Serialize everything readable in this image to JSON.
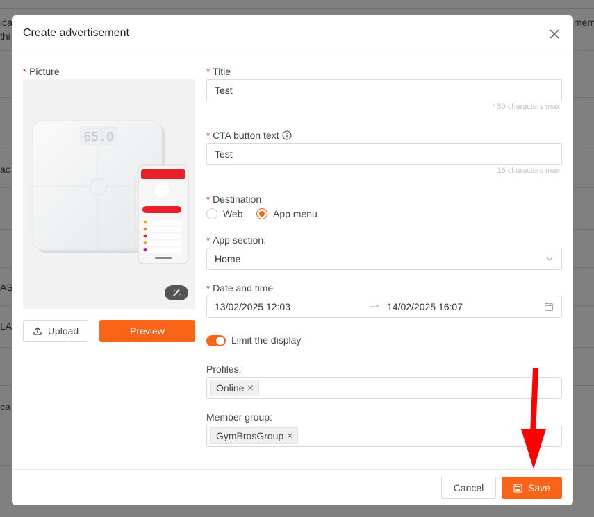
{
  "background": {
    "fragments": [
      "ica",
      "thi",
      "mem",
      "ac",
      "AS",
      "LAU",
      "ca"
    ]
  },
  "modal": {
    "title": "Create advertisement",
    "picture_label": "Picture",
    "upload_label": "Upload",
    "preview_label": "Preview",
    "scale_display": "65.0",
    "title_field": {
      "label": "Title",
      "value": "Test",
      "hint": "* 50 characters max."
    },
    "cta_field": {
      "label": "CTA button text",
      "value": "Test",
      "hint": "15 characters max."
    },
    "destination": {
      "label": "Destination",
      "options": [
        {
          "label": "Web",
          "checked": false
        },
        {
          "label": "App menu",
          "checked": true
        }
      ]
    },
    "app_section": {
      "label": "App section:",
      "value": "Home"
    },
    "date_time": {
      "label": "Date and time",
      "start": "13/02/2025 12:03",
      "end": "14/02/2025 16:07"
    },
    "limit_display": {
      "label": "Limit the display",
      "enabled": true
    },
    "profiles": {
      "label": "Profiles:",
      "tags": [
        "Online"
      ]
    },
    "member_group": {
      "label": "Member group:",
      "tags": [
        "GymBrosGroup"
      ]
    },
    "cancel_label": "Cancel",
    "save_label": "Save"
  },
  "colors": {
    "accent": "#fa6419",
    "required": "#f5222d",
    "annotation_arrow": "#ff0000"
  }
}
